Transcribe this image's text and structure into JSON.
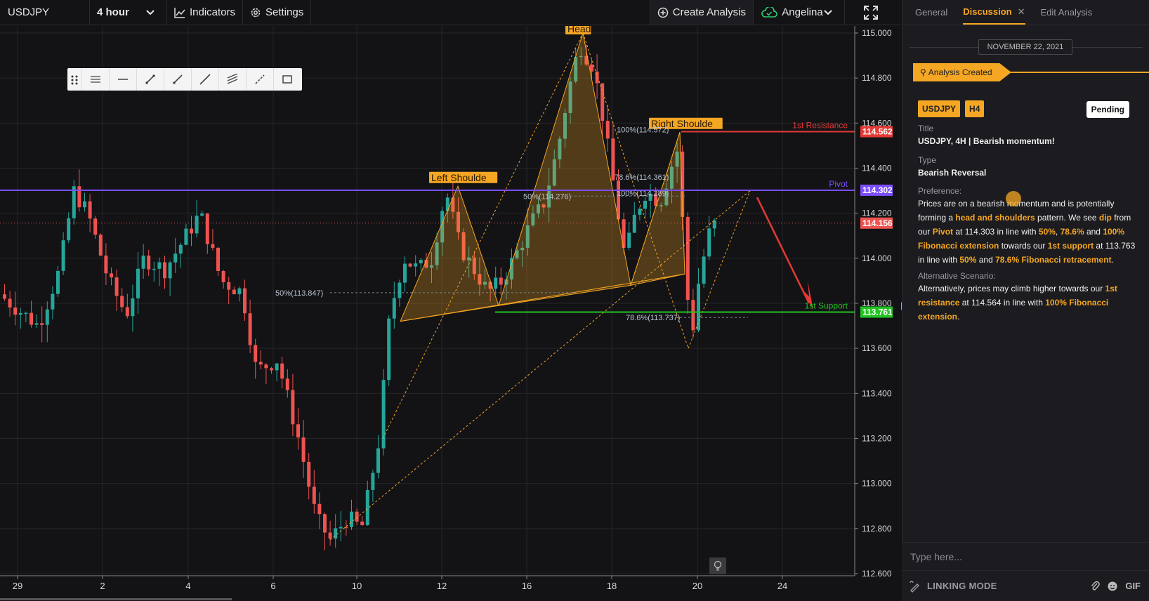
{
  "toolbar": {
    "symbol": "USDJPY",
    "interval": "4 hour",
    "indicators_label": "Indicators",
    "settings_label": "Settings",
    "create_analysis_label": "Create Analysis",
    "user_name": "Angelina"
  },
  "drawing_tools": [
    "drag-handle-icon",
    "lines-menu-icon",
    "horizontal-line-icon",
    "trend-line-icon",
    "ray-icon",
    "extended-line-icon",
    "parallel-channel-icon",
    "fib-tool-icon",
    "rectangle-icon"
  ],
  "chart": {
    "price_axis": [
      "115.000",
      "114.800",
      "114.600",
      "114.400",
      "114.200",
      "114.000",
      "113.800",
      "113.600",
      "113.400",
      "113.200",
      "113.000",
      "112.800",
      "112.600"
    ],
    "date_axis": [
      "29",
      "2",
      "4",
      "6",
      "10",
      "12",
      "16",
      "18",
      "20",
      "24"
    ],
    "current_price": "114.156",
    "levels": {
      "resistance": {
        "label": "1st Resistance",
        "price": "114.562",
        "color": "#e53935"
      },
      "pivot": {
        "label": "Pivot",
        "price": "114.302",
        "color": "#7c4dff"
      },
      "support": {
        "label": "1st Support",
        "price": "113.761",
        "color": "#22c322"
      }
    },
    "pattern_labels": [
      "Left Shoulde",
      "Head",
      "Right Shoulde"
    ],
    "fib_labels": [
      "50%(113.847)",
      "50%(114.276)",
      "100%(114.572)",
      "78.6%(114.361)",
      "100%(114.289)",
      "78.6%(113.737)"
    ],
    "colors": {
      "up": "#26a69a",
      "down": "#ef5350",
      "pattern": "#f5a623",
      "bg": "#131316",
      "grid": "#26262a"
    }
  },
  "panel": {
    "tabs": [
      "General",
      "Discussion",
      "Edit Analysis"
    ],
    "active_tab": "Discussion",
    "date": "NOVEMBER 22, 2021",
    "event": "Analysis Created",
    "tags": [
      "USDJPY",
      "H4"
    ],
    "status": "Pending",
    "title_label": "Title",
    "title_value": "USDJPY, 4H | Bearish momentum!",
    "type_label": "Type",
    "type_value": "Bearish Reversal",
    "preference_label": "Preference:",
    "preference_parts": [
      {
        "t": "Prices are on a bearish momentum and is potentially forming a ",
        "h": false
      },
      {
        "t": "head and shoulders",
        "h": true
      },
      {
        "t": " pattern. We see ",
        "h": false
      },
      {
        "t": "dip",
        "h": true
      },
      {
        "t": " from our ",
        "h": false
      },
      {
        "t": "Pivot",
        "h": true
      },
      {
        "t": " at 114.303 in line with ",
        "h": false
      },
      {
        "t": "50%",
        "h": true
      },
      {
        "t": ", ",
        "h": false
      },
      {
        "t": "78.6%",
        "h": true
      },
      {
        "t": " and ",
        "h": false
      },
      {
        "t": "100% Fibonacci extension",
        "h": true
      },
      {
        "t": " towards our ",
        "h": false
      },
      {
        "t": "1st support",
        "h": true
      },
      {
        "t": " at 113.763 in line with ",
        "h": false
      },
      {
        "t": "50%",
        "h": true
      },
      {
        "t": " and ",
        "h": false
      },
      {
        "t": "78.6% Fibonacci retracement",
        "h": true
      },
      {
        "t": ".",
        "h": false
      }
    ],
    "alt_label": "Alternative Scenario:",
    "alt_parts": [
      {
        "t": "Alternatively, prices may climb higher towards our ",
        "h": false
      },
      {
        "t": "1st resistance",
        "h": true
      },
      {
        "t": " at 114.564 in line with ",
        "h": false
      },
      {
        "t": "100% Fibonacci extension",
        "h": true
      },
      {
        "t": ".",
        "h": false
      }
    ],
    "chat_placeholder": "Type here...",
    "linking_mode_label": "LINKING MODE",
    "gif_label": "GIF"
  }
}
